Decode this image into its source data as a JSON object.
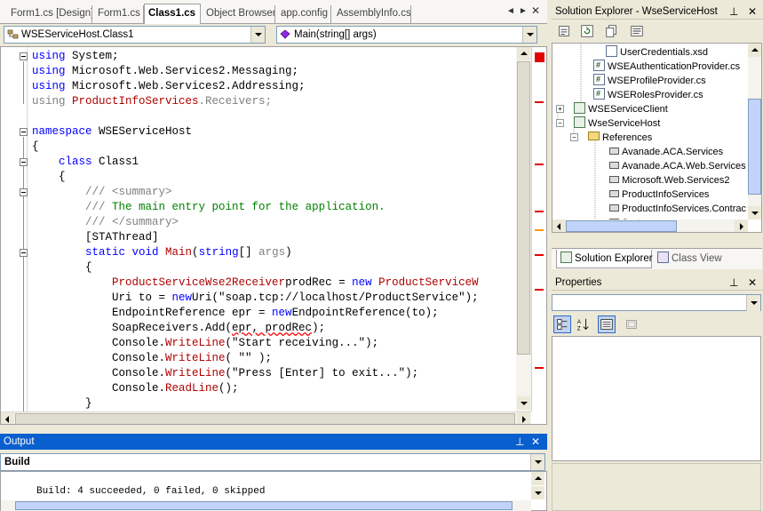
{
  "editor": {
    "tabs": [
      {
        "label": "Form1.cs [Design]",
        "active": false
      },
      {
        "label": "Form1.cs",
        "active": false
      },
      {
        "label": "Class1.cs",
        "active": true
      },
      {
        "label": "Object Browser",
        "active": false
      },
      {
        "label": "app.config",
        "active": false
      },
      {
        "label": "AssemblyInfo.cs",
        "active": false
      }
    ],
    "tab_nav": {
      "prev": "◄",
      "next": "►",
      "close": "✕"
    },
    "type_combo": "WSEServiceHost.Class1",
    "member_combo": "Main(string[] args)",
    "code_lines": [
      [
        [
          "kw",
          "using"
        ],
        [
          "",
          "System;"
        ]
      ],
      [
        [
          "kw",
          "using"
        ],
        [
          "",
          "Microsoft.Web.Services2.Messaging;"
        ]
      ],
      [
        [
          "kw",
          "using"
        ],
        [
          "",
          "Microsoft.Web.Services2.Addressing;"
        ]
      ],
      [
        [
          "gr",
          "using "
        ],
        [
          "ty",
          "ProductInfoServices"
        ],
        [
          "gr",
          ".Receivers;"
        ]
      ],
      [],
      [
        [
          "kw",
          "namespace"
        ],
        [
          "",
          "WSEServiceHost"
        ]
      ],
      [
        [
          "",
          "{"
        ]
      ],
      [
        [
          "",
          "    "
        ],
        [
          "kw",
          "class"
        ],
        [
          "",
          "Class1"
        ]
      ],
      [
        [
          "",
          "    {"
        ]
      ],
      [
        [
          "",
          "        "
        ],
        [
          "gr",
          "/// <summary>"
        ]
      ],
      [
        [
          "",
          "        "
        ],
        [
          "gr",
          "///"
        ],
        [
          "cm",
          " The main entry point for the application."
        ]
      ],
      [
        [
          "",
          "        "
        ],
        [
          "gr",
          "/// </summary>"
        ]
      ],
      [
        [
          "",
          "        [STAThread]"
        ]
      ],
      [
        [
          "",
          "        "
        ],
        [
          "kw",
          "static void"
        ],
        [
          "ty",
          " Main"
        ],
        [
          "",
          "("
        ],
        [
          "kw",
          "string"
        ],
        [
          "",
          "[] "
        ],
        [
          "dim",
          "args"
        ],
        [
          "",
          ")"
        ]
      ],
      [
        [
          "",
          "        {"
        ]
      ],
      [
        [
          "",
          "            "
        ],
        [
          "ty",
          "ProductServiceWse2Receiver"
        ],
        [
          "",
          ""
        ],
        [
          "",
          "prodRec = "
        ],
        [
          "kw",
          "new"
        ],
        [
          "ty",
          " ProductServiceW"
        ]
      ],
      [
        [
          "",
          "            Uri to = "
        ],
        [
          "kw",
          "new"
        ],
        [
          "",
          ""
        ],
        [
          "",
          "Uri(\"soap.tcp://localhost/ProductService\");"
        ]
      ],
      [
        [
          "",
          "            EndpointReference epr = "
        ],
        [
          "kw",
          "new"
        ],
        [
          "",
          ""
        ],
        [
          "",
          "EndpointReference(to);"
        ]
      ],
      [
        [
          "",
          "            SoapReceivers.Add("
        ],
        [
          "sq",
          "epr, prodRec"
        ],
        [
          "",
          ");"
        ]
      ],
      [
        [
          "",
          "            Console."
        ],
        [
          "ty",
          "WriteLine"
        ],
        [
          "",
          "(\"Start receiving...\");"
        ]
      ],
      [
        [
          "",
          "            Console."
        ],
        [
          "ty",
          "WriteLine"
        ],
        [
          "",
          "( \"\" );"
        ]
      ],
      [
        [
          "",
          "            Console."
        ],
        [
          "ty",
          "WriteLine"
        ],
        [
          "",
          "(\"Press [Enter] to exit...\");"
        ]
      ],
      [
        [
          "",
          "            Console."
        ],
        [
          "ty",
          "ReadLine"
        ],
        [
          "",
          "();"
        ]
      ],
      [
        [
          "",
          "        }"
        ]
      ]
    ]
  },
  "output": {
    "title": "Output",
    "pin": "⊥",
    "close": "✕",
    "source": "Build",
    "text": "Build: 4 succeeded, 0 failed, 0 skipped"
  },
  "solution_explorer": {
    "title": "Solution Explorer - WseServiceHost",
    "pin": "⊥",
    "close": "✕",
    "items": [
      {
        "label": "UserCredentials.xsd",
        "icon": "xsd-file-icon"
      },
      {
        "label": "WSEAuthenticationProvider.cs",
        "icon": "cs-file-icon"
      },
      {
        "label": "WSEProfileProvider.cs",
        "icon": "cs-file-icon"
      },
      {
        "label": "WSERolesProvider.cs",
        "icon": "cs-file-icon"
      },
      {
        "label": "WSEServiceClient",
        "icon": "project-icon",
        "expander": "+"
      },
      {
        "label": "WseServiceHost",
        "icon": "project-icon",
        "expander": "−"
      },
      {
        "label": "References",
        "icon": "references-folder-icon",
        "expander": "−"
      },
      {
        "label": "Avanade.ACA.Services",
        "icon": "reference-icon"
      },
      {
        "label": "Avanade.ACA.Web.Services",
        "icon": "reference-icon"
      },
      {
        "label": "Microsoft.Web.Services2",
        "icon": "reference-icon"
      },
      {
        "label": "ProductInfoServices",
        "icon": "reference-icon"
      },
      {
        "label": "ProductInfoServices.Contrac",
        "icon": "reference-icon"
      },
      {
        "label": "System",
        "icon": "reference-icon"
      }
    ],
    "tab_solution": "Solution Explorer",
    "tab_class": "Class View"
  },
  "properties": {
    "title": "Properties",
    "pin": "⊥",
    "close": "✕",
    "object_combo": ""
  },
  "colors": {
    "keyword": "#0000ff",
    "type": "#b00000",
    "comment": "#008000",
    "active_title": "#0a5fce"
  }
}
